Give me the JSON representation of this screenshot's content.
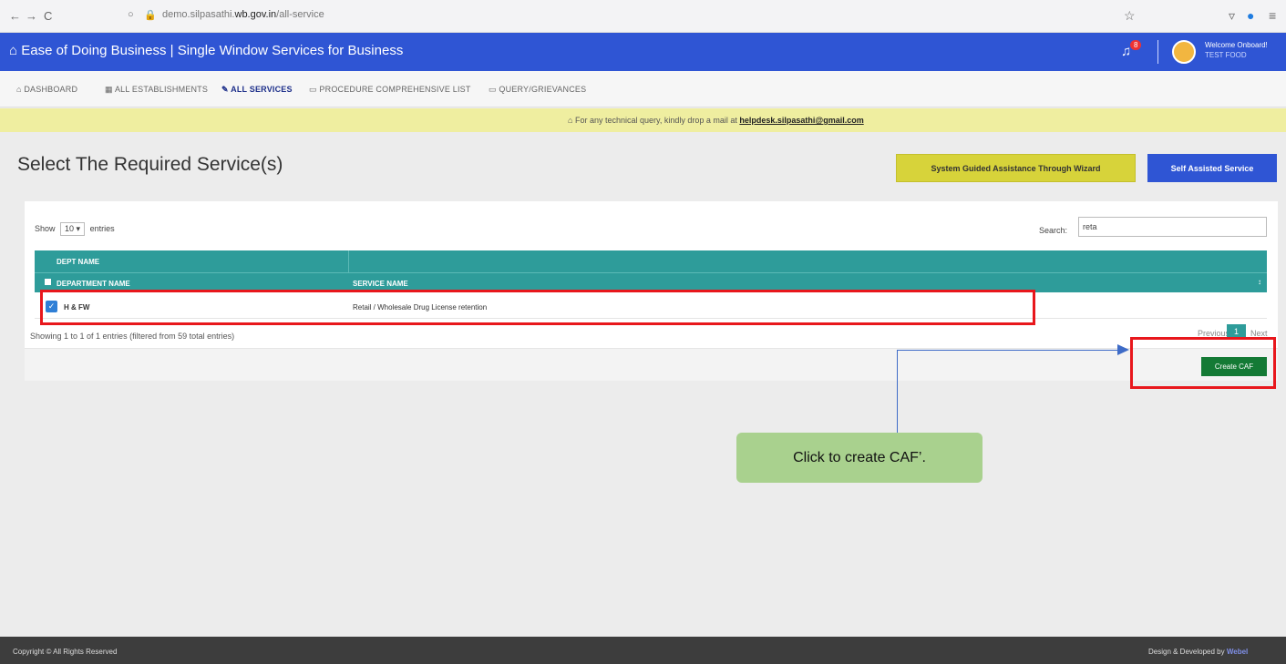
{
  "browser": {
    "back": "←",
    "forward": "→",
    "reload": "C",
    "url_prefix": "demo.silpasathi.",
    "url_domain": "wb.gov.in",
    "url_suffix": "/all-service"
  },
  "header": {
    "title": "Ease of Doing Business | Single Window Services for Business",
    "notification_count": "8",
    "welcome": "Welcome Onboard!",
    "user": "TEST FOOD"
  },
  "nav": {
    "items": [
      "DASHBOARD",
      "ALL ESTABLISHMENTS",
      "ALL SERVICES",
      "PROCEDURE COMPREHENSIVE LIST",
      "QUERY/GRIEVANCES"
    ]
  },
  "notice": {
    "text": "For any technical query, kindly drop a mail at",
    "email": "helpdesk.silpasathi@gmail.com"
  },
  "page": {
    "title": "Select The Required Service(s)",
    "wizard_button": "System Guided Assistance Through Wizard",
    "self_button": "Self Assisted Service"
  },
  "table": {
    "show_label": "Show",
    "show_value": "10",
    "entries_label": "entries",
    "search_label": "Search:",
    "search_value": "reta",
    "group_header": "DEPT NAME",
    "columns": [
      "DEPARTMENT NAME",
      "SERVICE NAME"
    ],
    "rows": [
      {
        "checked": true,
        "department": "H & FW",
        "service": "Retail / Wholesale Drug License retention"
      }
    ],
    "info": "Showing 1 to 1 of 1 entries (filtered from 59 total entries)",
    "prev": "Previous",
    "page": "1",
    "next": "Next",
    "create_button": "Create CAF"
  },
  "annotation": {
    "callout": "Click to create CAF’.",
    "highlight_color": "#e8171c",
    "callout_color": "#a9d18e"
  },
  "footer": {
    "left": "Copyright © All Rights Reserved",
    "right": "Design & Developed by",
    "brand": "Webel"
  }
}
